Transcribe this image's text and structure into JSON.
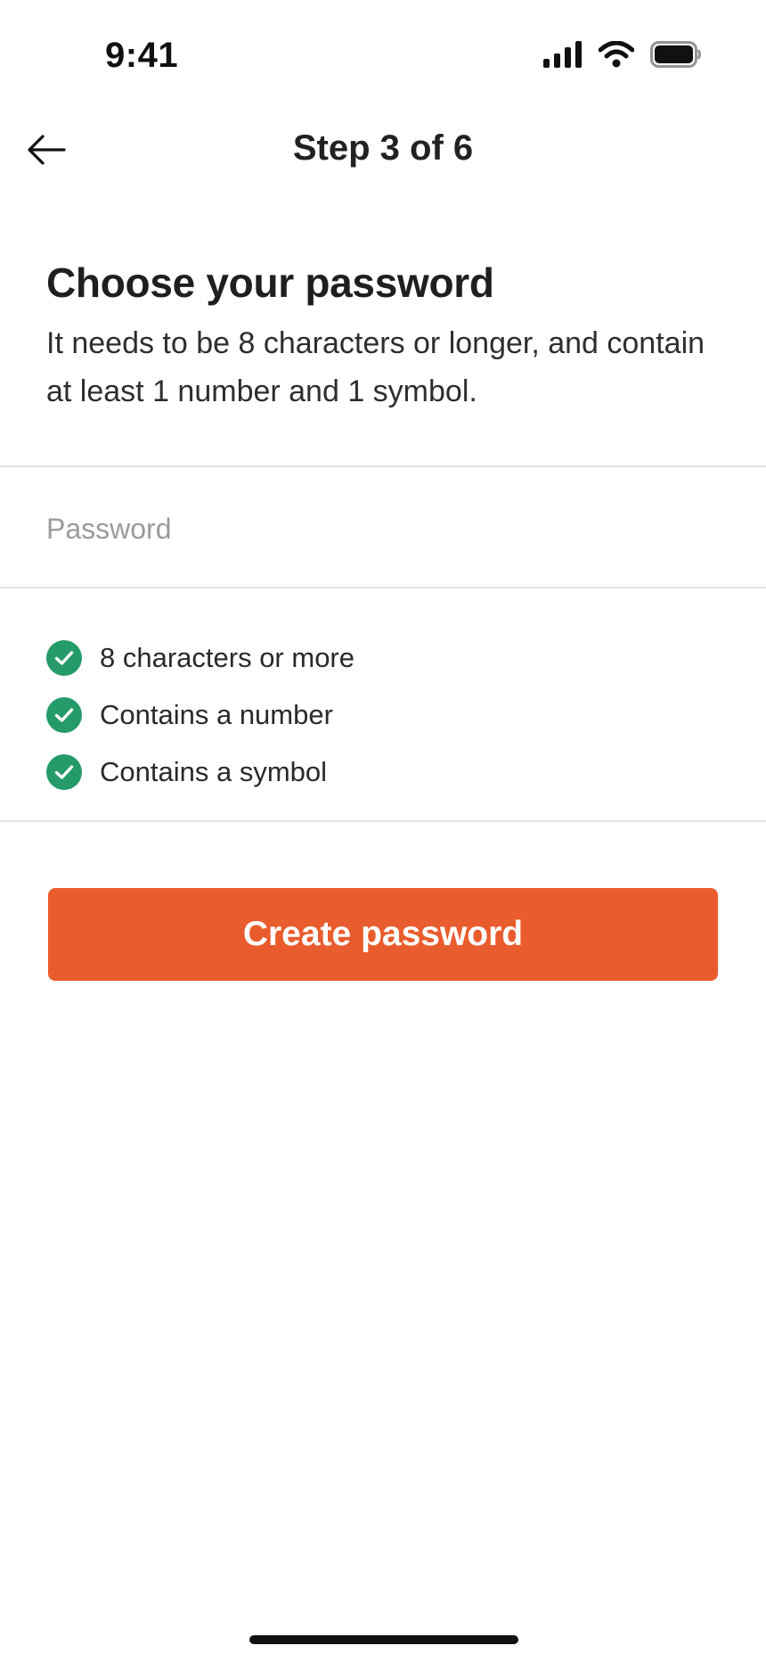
{
  "status_bar": {
    "time": "9:41"
  },
  "header": {
    "title": "Step 3 of 6"
  },
  "content": {
    "heading": "Choose your password",
    "description": "It needs to be 8 characters or longer, and contain at least 1 number and 1 symbol."
  },
  "password": {
    "value": "",
    "placeholder": "Password"
  },
  "requirements": [
    {
      "label": "8 characters or more",
      "met": true
    },
    {
      "label": "Contains a number",
      "met": true
    },
    {
      "label": "Contains a symbol",
      "met": true
    }
  ],
  "primary_action": {
    "label": "Create password"
  },
  "colors": {
    "accent": "#e95c2d",
    "success": "#259b6a",
    "divider": "#e6e6e6",
    "placeholder": "#9b9b9b"
  },
  "icons": {
    "back": "arrow-left-icon",
    "check": "check-circle-icon",
    "signal": "cellular-signal-icon",
    "wifi": "wifi-icon",
    "battery": "battery-icon"
  }
}
